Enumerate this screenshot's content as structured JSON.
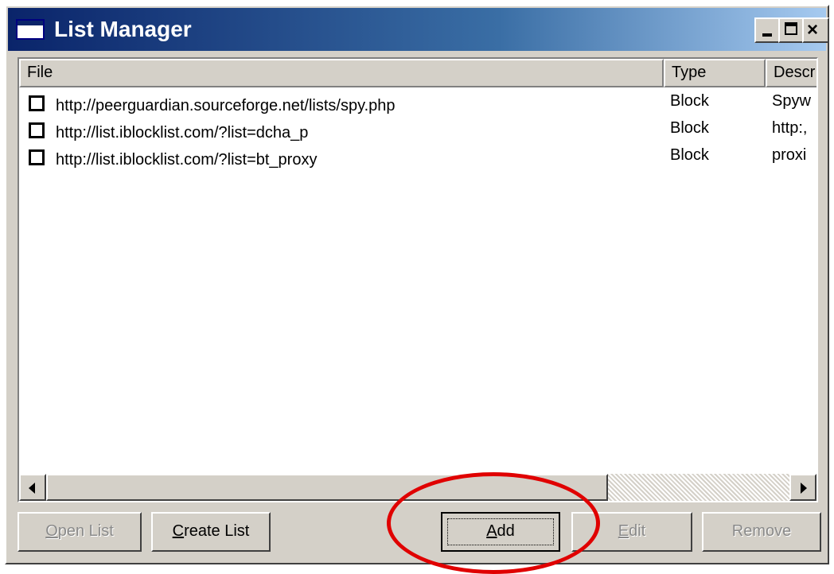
{
  "window": {
    "title": "List Manager",
    "controls": {
      "minimize": "_",
      "maximize": "□",
      "close": "×"
    }
  },
  "list": {
    "columns": [
      "File",
      "Type",
      "Descr"
    ],
    "rows": [
      {
        "checked": false,
        "file": "http://peerguardian.sourceforge.net/lists/spy.php",
        "type": "Block",
        "desc": "Spyw"
      },
      {
        "checked": false,
        "file": "http://list.iblocklist.com/?list=dcha_p",
        "type": "Block",
        "desc": "http:,"
      },
      {
        "checked": false,
        "file": "http://list.iblocklist.com/?list=bt_proxy",
        "type": "Block",
        "desc": "proxi"
      }
    ]
  },
  "buttons": {
    "open_list": {
      "accel": "O",
      "rest": "pen List",
      "enabled": false
    },
    "create_list": {
      "accel": "C",
      "rest": "reate List",
      "enabled": true
    },
    "add": {
      "accel": "A",
      "rest": "dd",
      "enabled": true,
      "focused": true
    },
    "edit": {
      "accel": "E",
      "rest": "dit",
      "enabled": false
    },
    "remove": {
      "label": "Remove",
      "enabled": false
    }
  },
  "colors": {
    "annotation_circle": "#e00000",
    "titlebar_start": "#0a246a",
    "titlebar_end": "#a6caf0",
    "face": "#d4d0c8"
  }
}
